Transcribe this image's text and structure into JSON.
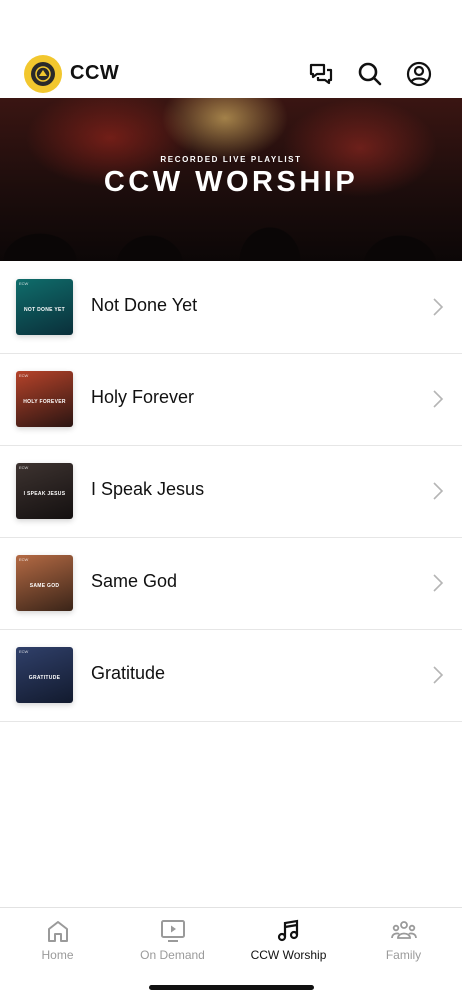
{
  "header": {
    "brand": "CCW",
    "colors": {
      "logo": "#f2c72e"
    },
    "icons": [
      "chat-icon",
      "search-icon",
      "account-icon"
    ]
  },
  "banner": {
    "subtitle": "RECORDED LIVE PLAYLIST",
    "title": "CCW WORSHIP"
  },
  "songs": [
    {
      "title": "Not Done Yet",
      "thumb_text": "NOT DONE YET",
      "thumb_tag": "ECW",
      "thumb_colors": [
        "#0f6d6b",
        "#0a2f3a"
      ]
    },
    {
      "title": "Holy Forever",
      "thumb_text": "HOLY FOREVER",
      "thumb_tag": "ECW",
      "thumb_colors": [
        "#b6432a",
        "#2b1512"
      ]
    },
    {
      "title": "I Speak Jesus",
      "thumb_text": "I SPEAK JESUS",
      "thumb_tag": "ECW",
      "thumb_colors": [
        "#3d3330",
        "#141010"
      ]
    },
    {
      "title": "Same God",
      "thumb_text": "SAME GOD",
      "thumb_tag": "ECW",
      "thumb_colors": [
        "#b46a44",
        "#3a2418"
      ]
    },
    {
      "title": "Gratitude",
      "thumb_text": "GRATITUDE",
      "thumb_tag": "ECW",
      "thumb_colors": [
        "#30406a",
        "#121a2e"
      ]
    }
  ],
  "tabs": [
    {
      "label": "Home",
      "icon": "home-icon",
      "active": false
    },
    {
      "label": "On Demand",
      "icon": "play-screen-icon",
      "active": false
    },
    {
      "label": "CCW Worship",
      "icon": "music-note-icon",
      "active": true
    },
    {
      "label": "Family",
      "icon": "family-icon",
      "active": false
    }
  ]
}
